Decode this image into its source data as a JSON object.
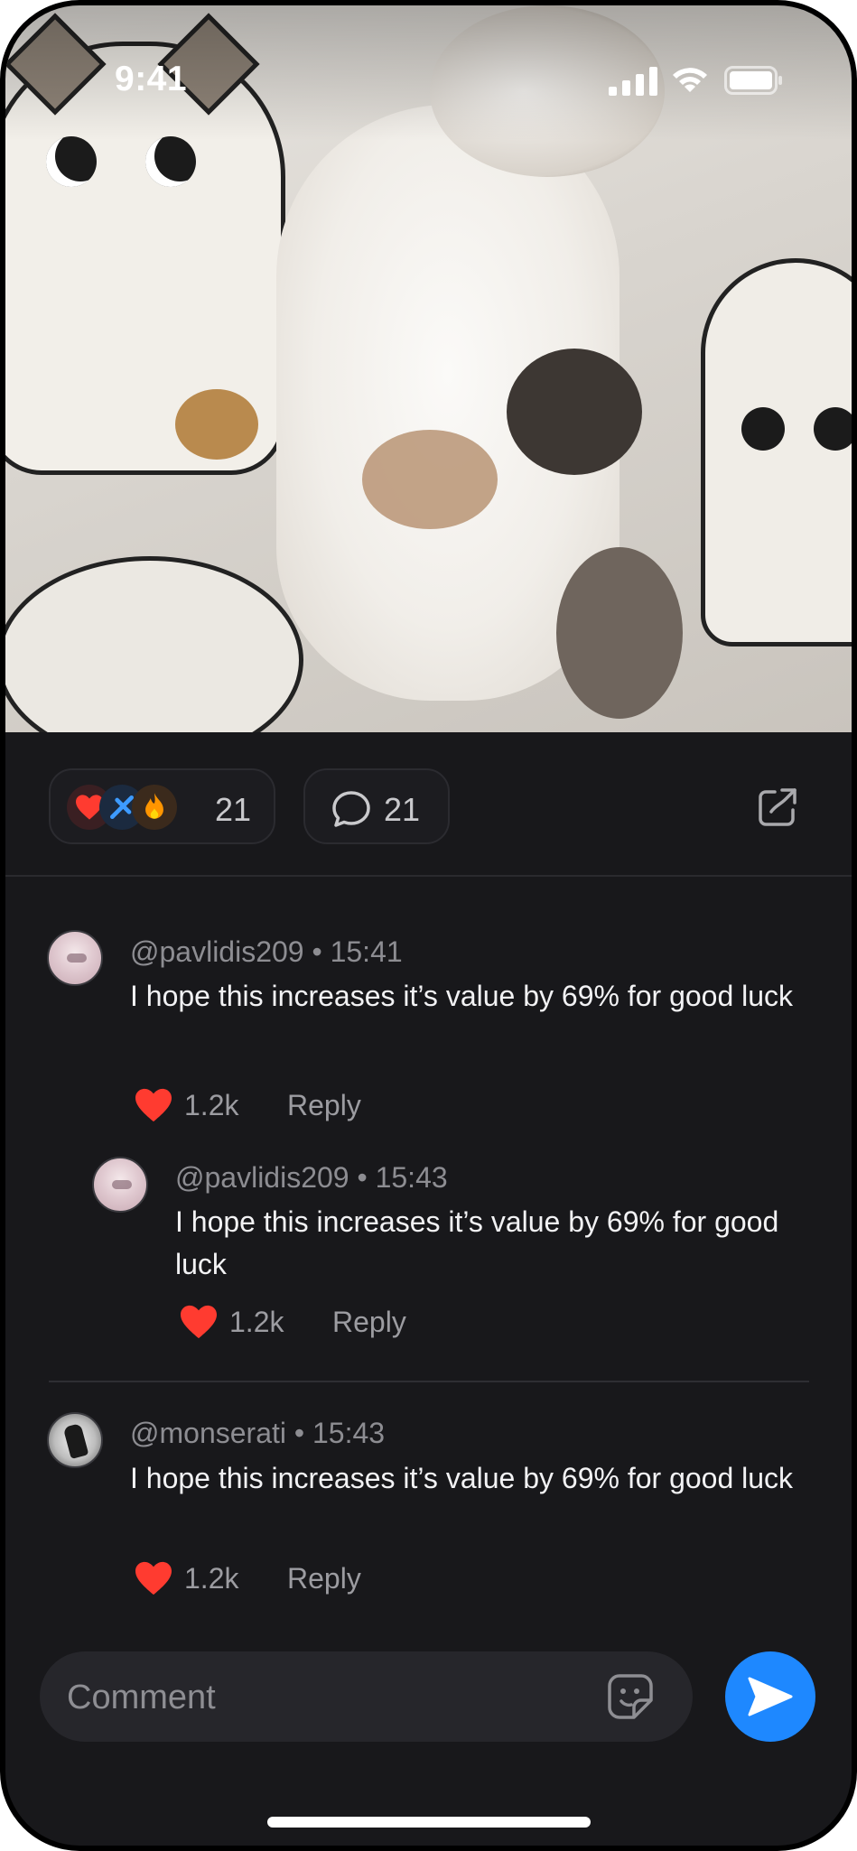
{
  "status_bar": {
    "time": "9:41"
  },
  "post": {
    "image_alt": "Fat white and tabby cat lying on back on cartoon cat bedsheet",
    "reactions": {
      "emojis": [
        "heart-emoji",
        "broken-blue-emoji",
        "fire-emoji"
      ],
      "count": "21"
    },
    "comments_count": "21"
  },
  "comments": [
    {
      "user": "@pavlidis209",
      "time": "15:41",
      "text": "I hope this increases it’s value by 69% for good luck",
      "likes": "1.2k",
      "reply_label": "Reply",
      "avatar": "anime-avatar"
    },
    {
      "user": "@pavlidis209",
      "time": "15:43",
      "text": "I hope this increases it’s value by 69% for good luck",
      "likes": "1.2k",
      "reply_label": "Reply",
      "avatar": "anime-avatar",
      "nested": true
    },
    {
      "user": "@monserati",
      "time": "15:43",
      "text": "I hope this increases it’s value by 69% for good luck",
      "likes": "1.2k",
      "reply_label": "Reply",
      "avatar": "bw-avatar"
    }
  ],
  "composer": {
    "placeholder": "Comment"
  },
  "colors": {
    "background": "#18181b",
    "accent": "#1e88ff",
    "heart": "#ff3b30"
  }
}
